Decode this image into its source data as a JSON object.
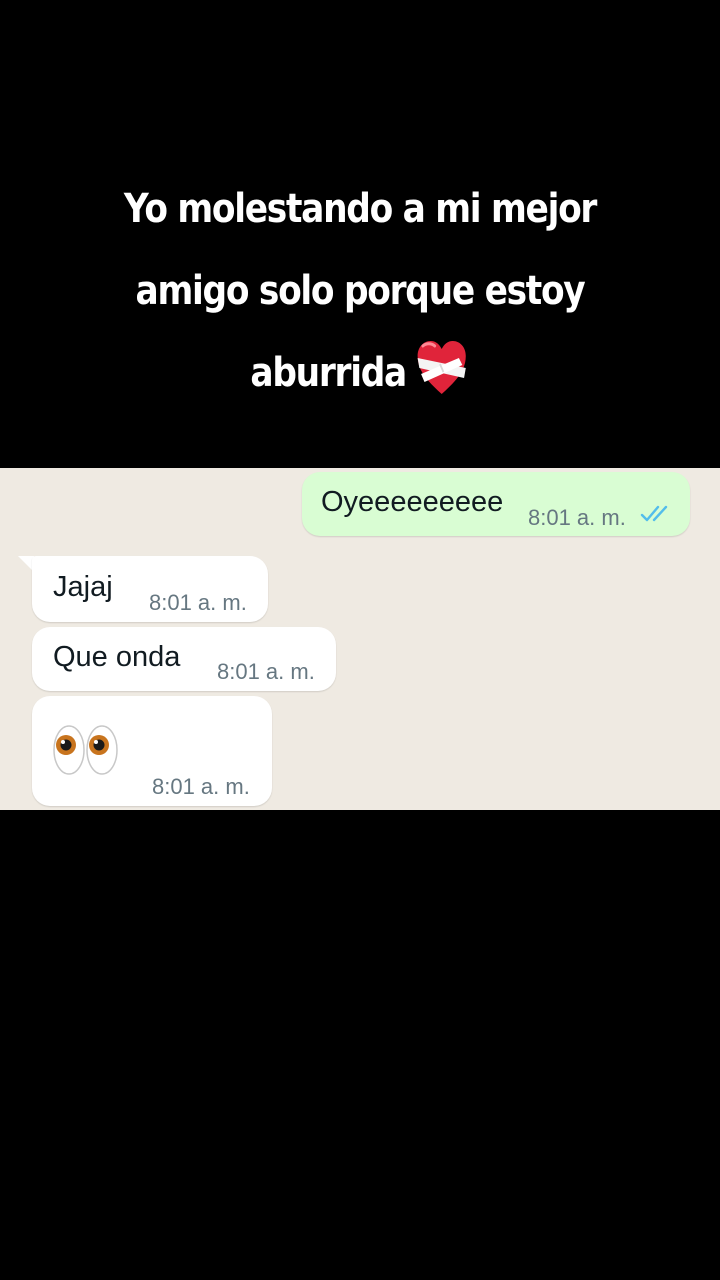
{
  "caption": {
    "line1": "Yo molestando a mi mejor",
    "line2": "amigo solo porque estoy",
    "line3": "aburrida",
    "emoji": "mending-heart-icon"
  },
  "messages": [
    {
      "direction": "outgoing",
      "text": "Oyeeeeeeeee",
      "time": "8:01 a. m.",
      "status": "read-double-check-icon"
    },
    {
      "direction": "incoming",
      "text": "Jajaj",
      "time": "8:01 a. m."
    },
    {
      "direction": "incoming",
      "text": "Que onda",
      "time": "8:01 a. m."
    },
    {
      "direction": "incoming",
      "text": "",
      "emoji": "eyes-icon",
      "time": "8:01 a. m."
    }
  ],
  "colors": {
    "background": "#000000",
    "chat_background": "#efeae2",
    "outgoing_bubble": "#d9fdd3",
    "incoming_bubble": "#ffffff",
    "read_ticks": "#53bdeb",
    "time_text": "#667781"
  }
}
